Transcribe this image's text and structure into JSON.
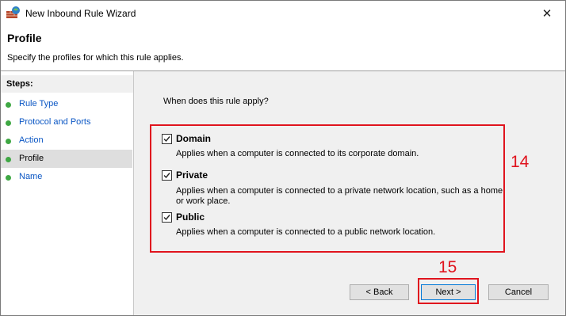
{
  "window": {
    "title": "New Inbound Rule Wizard",
    "close_glyph": "✕"
  },
  "header": {
    "title": "Profile",
    "subtitle": "Specify the profiles for which this rule applies."
  },
  "sidebar": {
    "heading": "Steps:",
    "items": [
      {
        "label": "Rule Type",
        "active": false
      },
      {
        "label": "Protocol and Ports",
        "active": false
      },
      {
        "label": "Action",
        "active": false
      },
      {
        "label": "Profile",
        "active": true
      },
      {
        "label": "Name",
        "active": false
      }
    ]
  },
  "main": {
    "question": "When does this rule apply?",
    "options": [
      {
        "title": "Domain",
        "checked": true,
        "description": "Applies when a computer is connected to its corporate domain."
      },
      {
        "title": "Private",
        "checked": true,
        "description": "Applies when a computer is connected to a private network location, such as a home or work place."
      },
      {
        "title": "Public",
        "checked": true,
        "description": "Applies when a computer is connected to a public network location."
      }
    ],
    "annotations": {
      "options_box": "14",
      "next_box": "15"
    }
  },
  "buttons": {
    "back": "< Back",
    "next": "Next >",
    "cancel": "Cancel"
  },
  "colors": {
    "annotation": "#e0141e",
    "link": "#0a56c4",
    "step_dot": "#3fa844",
    "content_bg": "#f0f0f0"
  }
}
